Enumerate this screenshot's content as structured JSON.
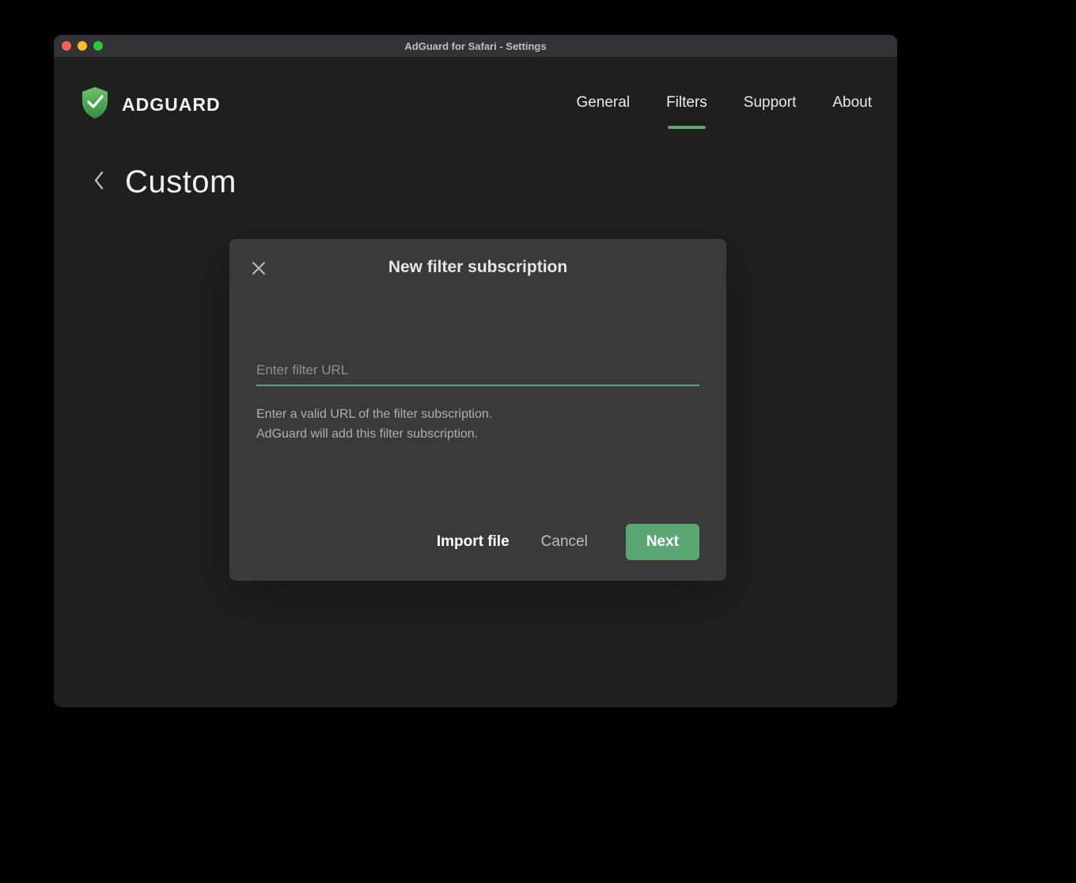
{
  "window": {
    "title": "AdGuard for Safari - Settings"
  },
  "brand": {
    "name": "ADGUARD"
  },
  "nav": {
    "items": [
      {
        "label": "General",
        "active": false
      },
      {
        "label": "Filters",
        "active": true
      },
      {
        "label": "Support",
        "active": false
      },
      {
        "label": "About",
        "active": false
      }
    ]
  },
  "page": {
    "title": "Custom"
  },
  "modal": {
    "title": "New filter subscription",
    "url_placeholder": "Enter filter URL",
    "url_value": "",
    "help_line1": "Enter a valid URL of the filter subscription.",
    "help_line2": "AdGuard will add this filter subscription.",
    "buttons": {
      "import": "Import file",
      "cancel": "Cancel",
      "next": "Next"
    }
  },
  "colors": {
    "accent": "#5aa773"
  }
}
